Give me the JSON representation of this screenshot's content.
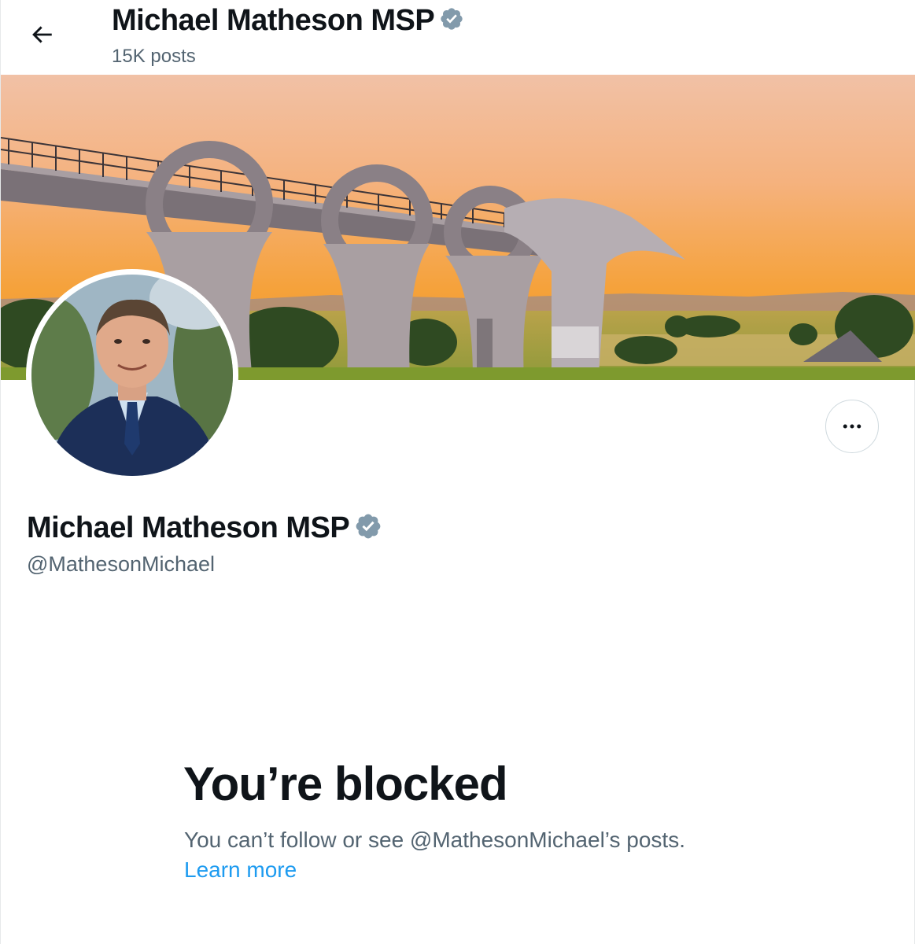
{
  "header": {
    "title": "Michael Matheson MSP",
    "post_count": "15K posts",
    "back_icon": "arrow-left-icon"
  },
  "profile": {
    "display_name": "Michael Matheson MSP",
    "handle": "@MathesonMichael",
    "verified_icon": "verified-badge-icon",
    "more_icon": "more-horizontal-icon"
  },
  "blocked": {
    "title": "You’re blocked",
    "message": "You can’t follow or see @MathesonMichael’s posts.",
    "link": "Learn more"
  },
  "colors": {
    "text_primary": "#0f1419",
    "text_secondary": "#536471",
    "link": "#1d9bf0",
    "verified_badge": "#829aab"
  }
}
